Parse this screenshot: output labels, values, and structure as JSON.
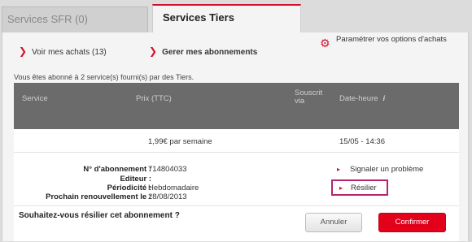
{
  "tabs": [
    {
      "label": "Services SFR (0)"
    },
    {
      "label": "Services Tiers"
    }
  ],
  "nav": {
    "achats": "Voir mes achats (13)",
    "abonnements": "Gerer mes abonnements",
    "parametres": "Paramétrer vos options d'achats"
  },
  "info_line": "Vous êtes abonné à 2 service(s) fourni(s) par des Tiers.",
  "table": {
    "headers": {
      "service": "Service",
      "prix": "Prix (TTC)",
      "souscrit_line1": "Souscrit",
      "souscrit_line2": "via",
      "date": "Date-heure"
    }
  },
  "subscription": {
    "price": "1,99€  par semaine",
    "datetime": "15/05 - 14:36",
    "labels": {
      "numero": "N° d'abonnement :",
      "editeur": "Editeur :",
      "periodicite": "Périodicité :",
      "renouvellement": "Prochain renouvellement le :"
    },
    "values": {
      "numero": "714804033",
      "editeur": "",
      "periodicite": "Hebdomadaire",
      "renouvellement": "28/08/2013"
    }
  },
  "actions": {
    "signaler": "Signaler un problème",
    "resilier": "Résilier"
  },
  "confirm": {
    "question": "Souhaitez-vous résilier cet abonnement ?",
    "annuler": "Annuler",
    "confirmer": "Confirmer"
  },
  "colors": {
    "accent": "#d3102b",
    "confirm_button": "#e2001a",
    "highlight_border": "#b8226e",
    "table_header": "#6b6b6b"
  },
  "icons": [
    "chevron-right-icon",
    "gears-icon",
    "info-icon",
    "triangle-right-icon"
  ]
}
